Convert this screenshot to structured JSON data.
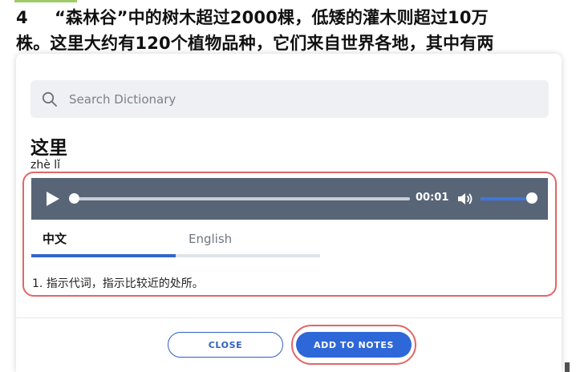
{
  "background": {
    "line1_number": "4",
    "line1_text": "“森林谷”中的树木超过2000棵，低矮的灌木则超过10万",
    "line2_text": "株。这里大约有120个植物品种，它们来自世界各地，其中有两"
  },
  "search": {
    "placeholder": "Search Dictionary"
  },
  "entry": {
    "word": "这里",
    "pinyin": "zhè lǐ"
  },
  "player": {
    "time": "00:01",
    "progress_fraction": 0.0,
    "volume_fraction": 1.0
  },
  "tabs": [
    {
      "label": "中文",
      "active": true
    },
    {
      "label": "English",
      "active": false
    }
  ],
  "definition": "1.  指示代词，指示比较近的处所。",
  "buttons": {
    "close": "CLOSE",
    "add_to_notes": "ADD TO NOTES"
  },
  "colors": {
    "primary": "#2e67d8",
    "player_bg": "#586577",
    "annotation_ring": "#e06767"
  }
}
